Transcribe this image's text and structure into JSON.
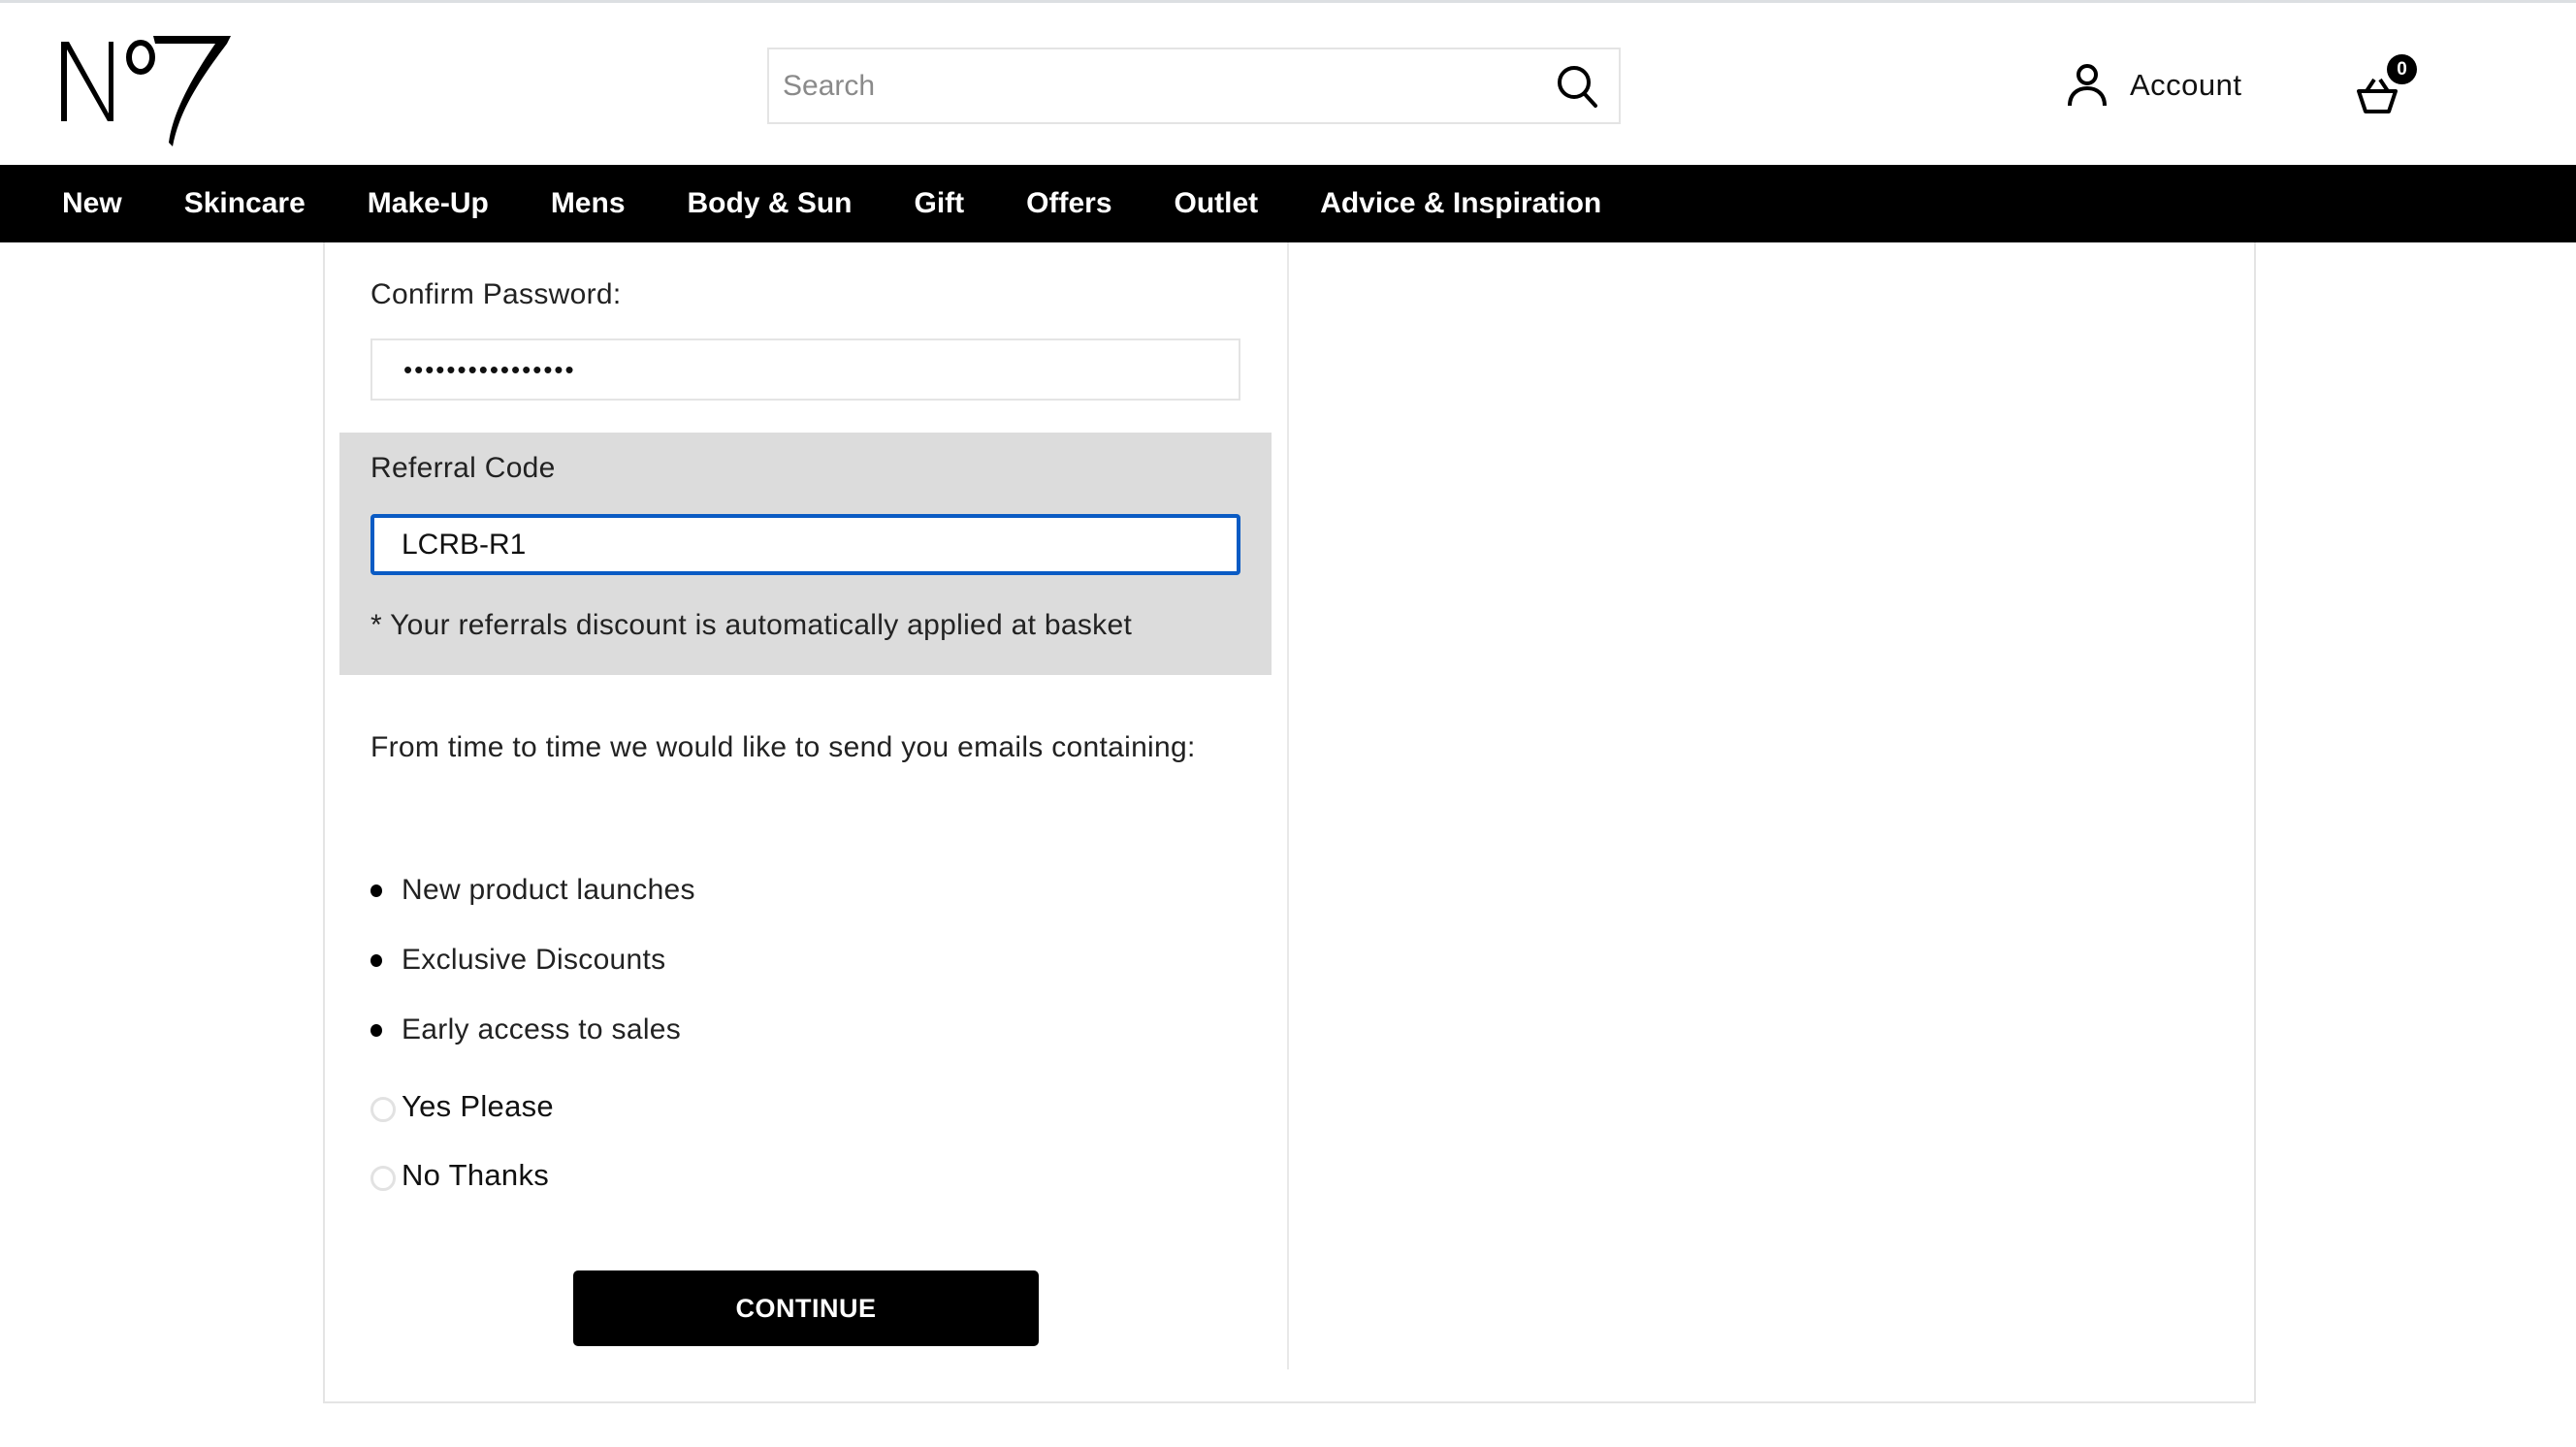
{
  "brand": {
    "logo_alt": "No7"
  },
  "header": {
    "search": {
      "placeholder": "Search",
      "value": ""
    },
    "account_label": "Account",
    "basket_label": "Basket",
    "basket_count": "0"
  },
  "nav": {
    "items": [
      {
        "label": "New"
      },
      {
        "label": "Skincare"
      },
      {
        "label": "Make-Up"
      },
      {
        "label": "Mens"
      },
      {
        "label": "Body & Sun"
      },
      {
        "label": "Gift"
      },
      {
        "label": "Offers"
      },
      {
        "label": "Outlet"
      },
      {
        "label": "Advice & Inspiration"
      }
    ]
  },
  "form": {
    "confirm_password_label": "Confirm Password:",
    "confirm_password_value": "••••••••••••••••",
    "referral": {
      "label": "Referral Code",
      "value": "LCRB-R1",
      "helper": "* Your referrals discount is automatically applied at basket",
      "focus_color": "#0a5bc4",
      "panel_color": "#dcdcdc"
    },
    "marketing_intro": "From time to time we would like to send you emails containing:",
    "marketing_items": [
      "New product launches",
      "Exclusive Discounts",
      "Early access to sales"
    ],
    "options": [
      {
        "label": "Yes Please",
        "selected": false
      },
      {
        "label": "No Thanks",
        "selected": false
      }
    ],
    "continue_label": "CONTINUE"
  }
}
